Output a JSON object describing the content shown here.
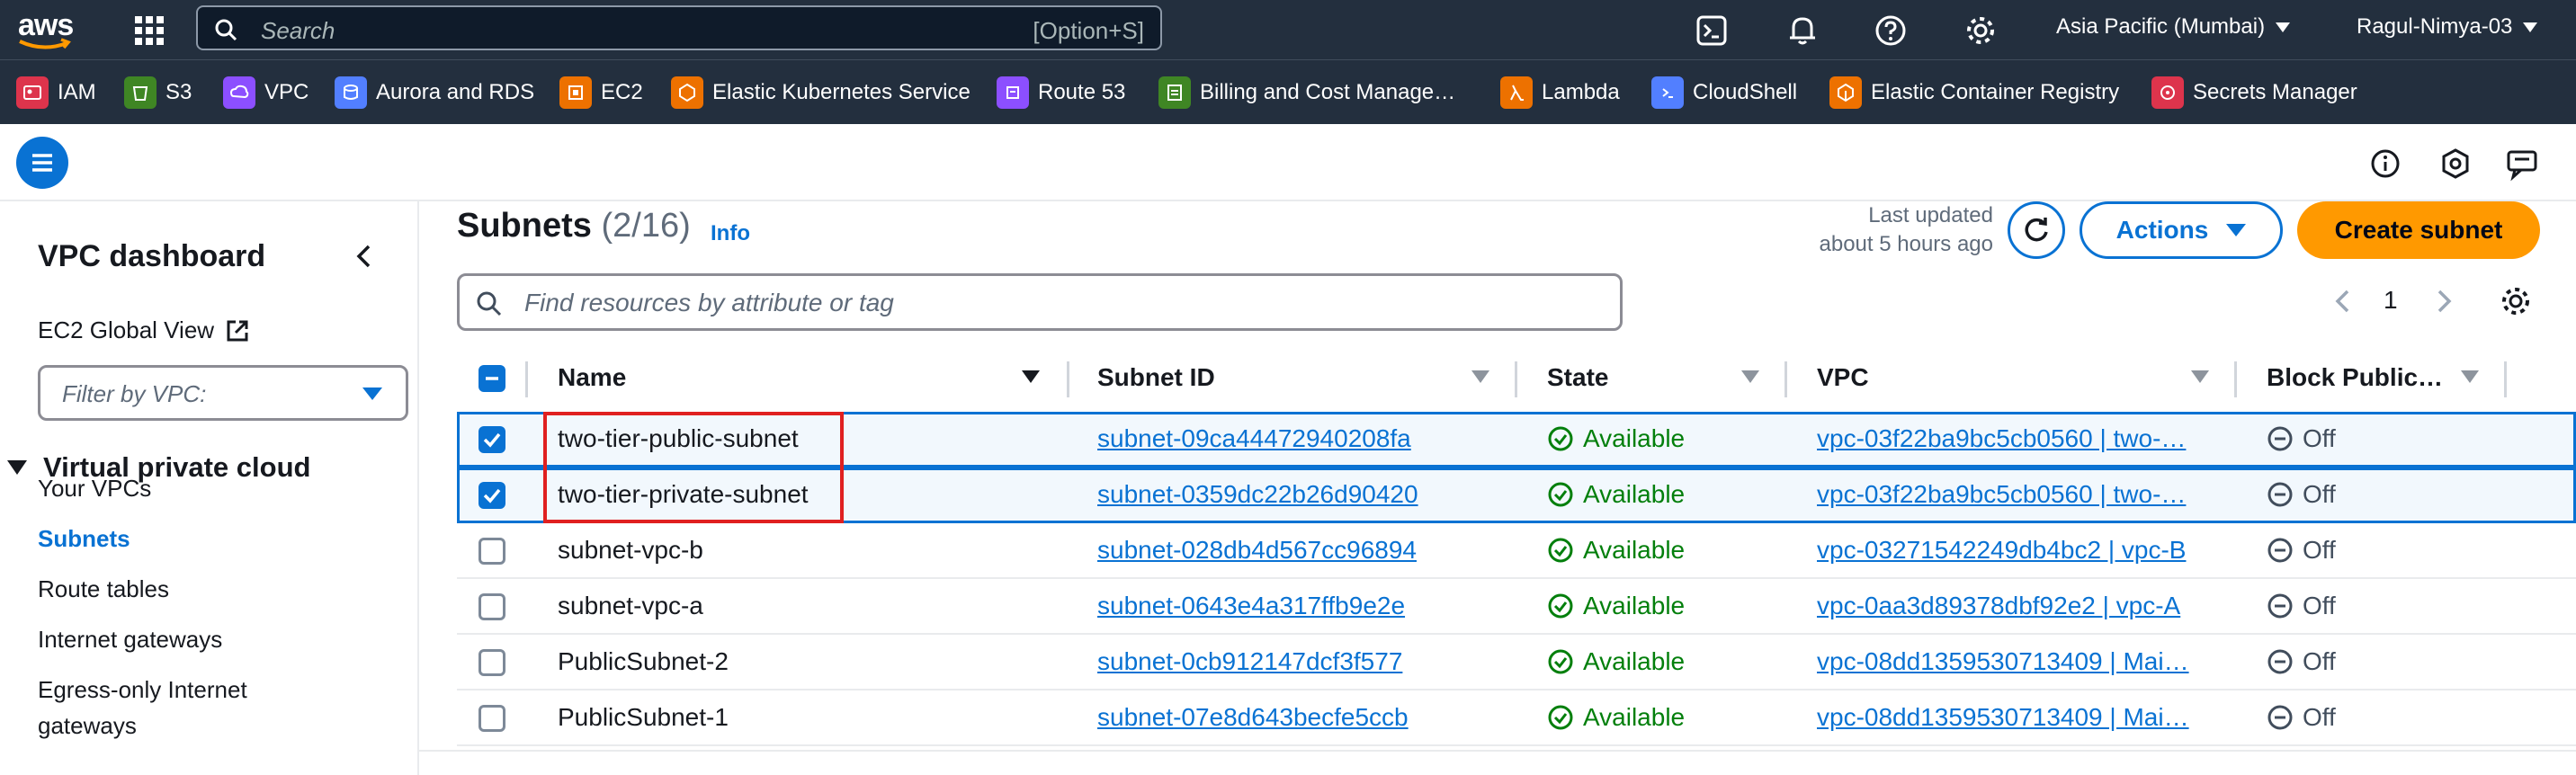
{
  "topnav": {
    "logo": "aws",
    "search_placeholder": "Search",
    "search_shortcut": "[Option+S]",
    "icons": [
      "cloudshell-icon",
      "bell-icon",
      "help-icon",
      "gear-icon"
    ],
    "region": "Asia Pacific (Mumbai)",
    "user": "Ragul-Nimya-03"
  },
  "favorites": [
    {
      "label": "IAM",
      "color": "#dd344c"
    },
    {
      "label": "S3",
      "color": "#3f8624"
    },
    {
      "label": "VPC",
      "color": "#8c4fff"
    },
    {
      "label": "Aurora and RDS",
      "color": "#527fff"
    },
    {
      "label": "EC2",
      "color": "#ed7100"
    },
    {
      "label": "Elastic Kubernetes Service",
      "color": "#ed7100"
    },
    {
      "label": "Route 53",
      "color": "#8c4fff"
    },
    {
      "label": "Billing and Cost Manage…",
      "color": "#3f8624"
    },
    {
      "label": "Lambda",
      "color": "#ed7100"
    },
    {
      "label": "CloudShell",
      "color": "#527fff"
    },
    {
      "label": "Elastic Container Registry",
      "color": "#ed7100"
    },
    {
      "label": "Secrets Manager",
      "color": "#dd344c"
    }
  ],
  "sidebar": {
    "title": "VPC dashboard",
    "ec2_global_view": "EC2 Global View",
    "filter_placeholder": "Filter by VPC:",
    "section": "Virtual private cloud",
    "items": [
      "Your VPCs",
      "Subnets",
      "Route tables",
      "Internet gateways",
      "Egress-only Internet",
      "gateways"
    ],
    "active_item": "Subnets"
  },
  "main": {
    "title": "Subnets",
    "count": "(2/16)",
    "info": "Info",
    "last_updated_line1": "Last updated",
    "last_updated_line2": "about 5 hours ago",
    "actions_label": "Actions",
    "create_label": "Create subnet",
    "find_placeholder": "Find resources by attribute or tag",
    "page": "1"
  },
  "table": {
    "columns": [
      "Name",
      "Subnet ID",
      "State",
      "VPC",
      "Block Public…"
    ],
    "rows": [
      {
        "selected": true,
        "name": "two-tier-public-subnet",
        "subnet_id": "subnet-09ca44472940208fa",
        "state": "Available",
        "vpc": "vpc-03f22ba9bc5cb0560 | two-…",
        "block": "Off"
      },
      {
        "selected": true,
        "name": "two-tier-private-subnet",
        "subnet_id": "subnet-0359dc22b26d90420",
        "state": "Available",
        "vpc": "vpc-03f22ba9bc5cb0560 | two-…",
        "block": "Off"
      },
      {
        "selected": false,
        "name": "subnet-vpc-b",
        "subnet_id": "subnet-028db4d567cc96894",
        "state": "Available",
        "vpc": "vpc-03271542249db4bc2 | vpc-B",
        "block": "Off"
      },
      {
        "selected": false,
        "name": "subnet-vpc-a",
        "subnet_id": "subnet-0643e4a317ffb9e2e",
        "state": "Available",
        "vpc": "vpc-0aa3d89378dbf92e2 | vpc-A",
        "block": "Off"
      },
      {
        "selected": false,
        "name": "PublicSubnet-2",
        "subnet_id": "subnet-0cb912147dcf3f577",
        "state": "Available",
        "vpc": "vpc-08dd1359530713409 | Mai…",
        "block": "Off"
      },
      {
        "selected": false,
        "name": "PublicSubnet-1",
        "subnet_id": "subnet-07e8d643becfe5ccb",
        "state": "Available",
        "vpc": "vpc-08dd1359530713409 | Mai…",
        "block": "Off"
      }
    ]
  },
  "colors": {
    "nav_bg": "#232f3e",
    "primary": "#0972d3",
    "accent": "#ff9900",
    "success": "#037f0c",
    "highlight": "#e02020"
  }
}
